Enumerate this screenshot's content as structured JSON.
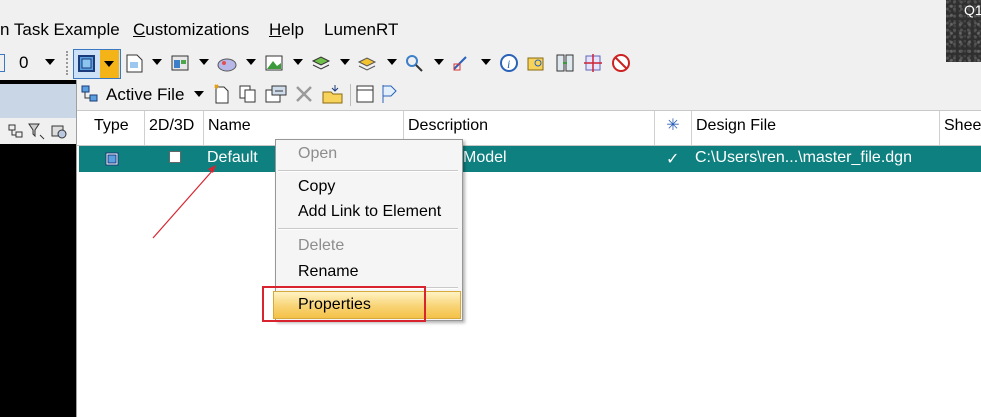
{
  "menubar": {
    "items": [
      {
        "label": "n Task Example",
        "underline": ""
      },
      {
        "label": "Customizations",
        "underline": "C"
      },
      {
        "label": "Help",
        "underline": "H"
      },
      {
        "label": "LumenRT",
        "underline": ""
      }
    ]
  },
  "corner": {
    "label": "Q1"
  },
  "toolbar": {
    "level_value": "0"
  },
  "dialog": {
    "scope_label": "Active File",
    "columns": [
      "Type",
      "2D/3D",
      "Name",
      "Description",
      "✳",
      "Design File",
      "Shee"
    ],
    "row": {
      "name": "Default",
      "description": "Model",
      "check": "✓",
      "design_file": "C:\\Users\\ren...\\master_file.dgn"
    }
  },
  "context_menu": {
    "open": "Open",
    "copy": "Copy",
    "add_link": "Add Link to Element",
    "delete": "Delete",
    "rename": "Rename",
    "properties": "Properties"
  },
  "colors": {
    "selection": "#0f8080",
    "annotation": "#d9232f",
    "menu_highlight": "#f8d374"
  }
}
